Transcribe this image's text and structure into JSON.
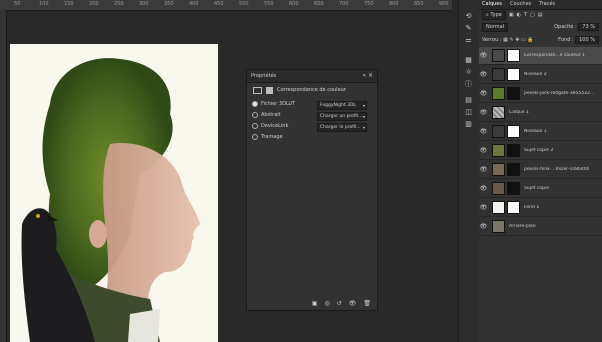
{
  "ruler": {
    "ticks": [
      "50",
      "100",
      "150",
      "200",
      "250",
      "300",
      "350",
      "400",
      "450",
      "500",
      "550",
      "600",
      "650",
      "700",
      "750",
      "800",
      "850",
      "900"
    ]
  },
  "properties": {
    "title": "Propriétés",
    "header_label": "Correspondance de couleur",
    "options": [
      {
        "label": "Fichier 3DLUT",
        "value": "FoggyNight.3DL",
        "selected": true
      },
      {
        "label": "Abstrait",
        "value": "Charger un profil...",
        "selected": false
      },
      {
        "label": "DeviceLink",
        "value": "Charger le profil...",
        "selected": false
      },
      {
        "label": "Tramage",
        "value": "",
        "selected": false
      }
    ]
  },
  "layers_panel": {
    "tabs": [
      "Calques",
      "Couches",
      "Tracés"
    ],
    "filter_label": "Type",
    "blend_mode": "Normal",
    "opacity_label": "Opacité :",
    "opacity_value": "73 %",
    "lock_label": "Verrou :",
    "fill_label": "Fond :",
    "fill_value": "100 %",
    "layers": [
      {
        "name": "Correspondan...e couleur 1",
        "selected": true
      },
      {
        "name": "Niveaux 2",
        "selected": false
      },
      {
        "name": "pexels-jack-redgate-3855522...",
        "selected": false
      },
      {
        "name": "Calque 1",
        "selected": false
      },
      {
        "name": "Niveaux 1",
        "selected": false
      },
      {
        "name": "Sujet copie 2",
        "selected": false
      },
      {
        "name": "pexels-felix-...mizer-1086400",
        "selected": false
      },
      {
        "name": "Sujet copie",
        "selected": false
      },
      {
        "name": "Fond 1",
        "selected": false
      },
      {
        "name": "Arrière-plan",
        "selected": false
      }
    ]
  }
}
